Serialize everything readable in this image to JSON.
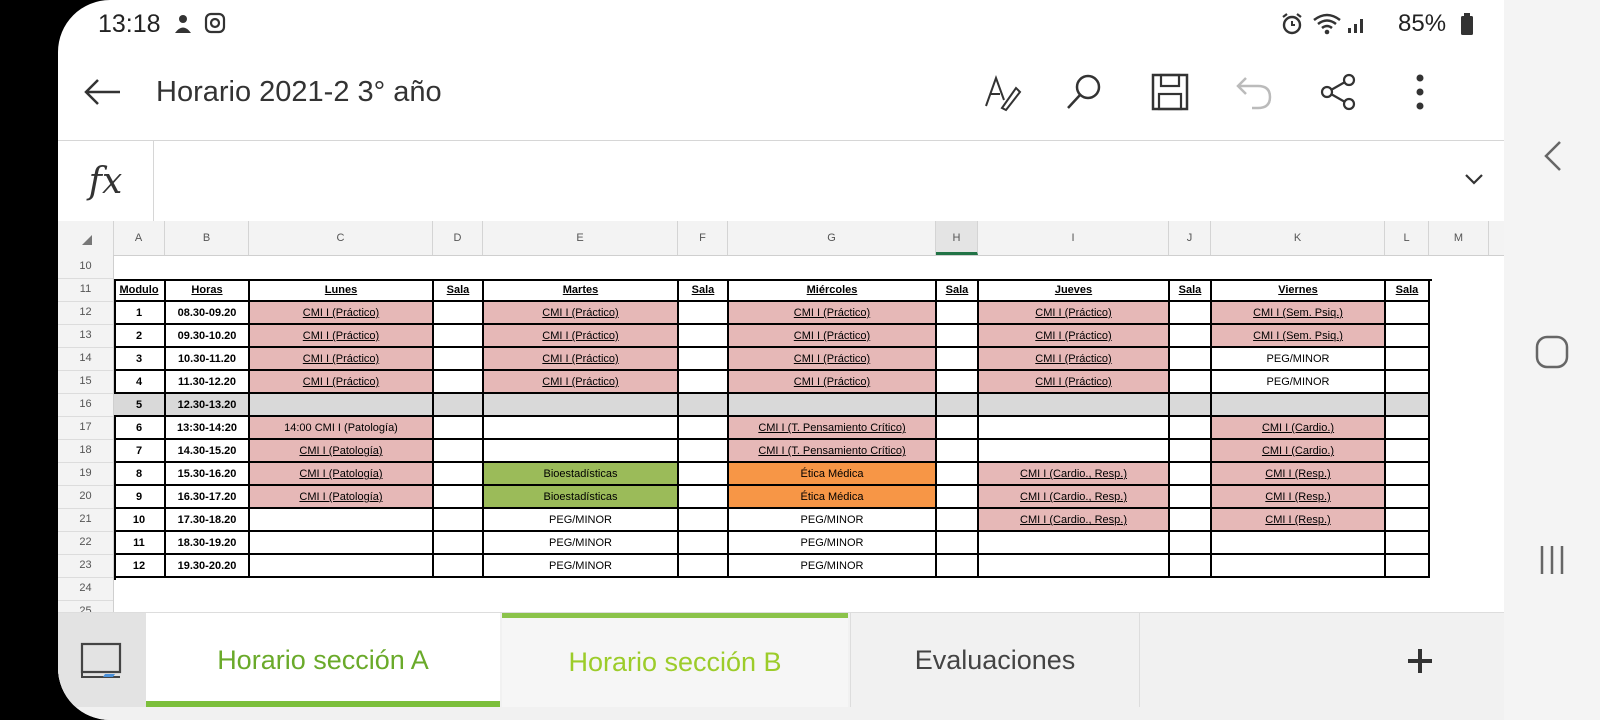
{
  "status": {
    "time": "13:18",
    "battery": "85%"
  },
  "app": {
    "title": "Horario 2021-2 3° año"
  },
  "formula": {
    "label": "fx",
    "value": ""
  },
  "columns": [
    "A",
    "B",
    "C",
    "D",
    "E",
    "F",
    "G",
    "H",
    "I",
    "J",
    "K",
    "L",
    "M"
  ],
  "selected_column": "H",
  "rows": [
    "10",
    "11",
    "12",
    "13",
    "14",
    "15",
    "16",
    "17",
    "18",
    "19",
    "20",
    "21",
    "22",
    "23",
    "24",
    "25"
  ],
  "table": {
    "headers": [
      "Modulo",
      "Horas",
      "Lunes",
      "Sala",
      "Martes",
      "Sala",
      "Miércoles",
      "Sala",
      "Jueves",
      "Sala",
      "Viernes",
      "Sala"
    ],
    "rows": [
      {
        "m": "1",
        "h": "08.30-09.20",
        "lun": "CMI I (Práctico)",
        "mar": "CMI I (Práctico)",
        "mie": "CMI I (Práctico)",
        "jue": "CMI I (Práctico)",
        "vie": "CMI I (Sem. Psiq.)"
      },
      {
        "m": "2",
        "h": "09.30-10.20",
        "lun": "CMI I (Práctico)",
        "mar": "CMI I (Práctico)",
        "mie": "CMI I (Práctico)",
        "jue": "CMI I (Práctico)",
        "vie": "CMI I (Sem. Psiq.)"
      },
      {
        "m": "3",
        "h": "10.30-11.20",
        "lun": "CMI I (Práctico)",
        "mar": "CMI I (Práctico)",
        "mie": "CMI I (Práctico)",
        "jue": "CMI I (Práctico)",
        "vie": "PEG/MINOR"
      },
      {
        "m": "4",
        "h": "11.30-12.20",
        "lun": "CMI I (Práctico)",
        "mar": "CMI I (Práctico)",
        "mie": "CMI I (Práctico)",
        "jue": "CMI I (Práctico)",
        "vie": "PEG/MINOR"
      },
      {
        "m": "5",
        "h": "12.30-13.20",
        "lun": "",
        "mar": "",
        "mie": "",
        "jue": "",
        "vie": ""
      },
      {
        "m": "6",
        "h": "13:30-14:20",
        "lun": "14:00 CMI I (Patología)",
        "mar": "",
        "mie": "CMI I (T. Pensamiento Crítico)",
        "jue": "",
        "vie": "CMI I (Cardio.)"
      },
      {
        "m": "7",
        "h": "14.30-15.20",
        "lun": "CMI I (Patología)",
        "mar": "",
        "mie": "CMI I (T. Pensamiento Crítico)",
        "jue": "",
        "vie": "CMI I (Cardio.)"
      },
      {
        "m": "8",
        "h": "15.30-16.20",
        "lun": "CMI I (Patología)",
        "mar": "Bioestadísticas",
        "mie": "Ética Médica",
        "jue": "CMI I (Cardio., Resp.)",
        "vie": "CMI I (Resp.)"
      },
      {
        "m": "9",
        "h": "16.30-17.20",
        "lun": "CMI I (Patología)",
        "mar": "Bioestadísticas",
        "mie": "Ética Médica",
        "jue": "CMI I (Cardio., Resp.)",
        "vie": "CMI I (Resp.)"
      },
      {
        "m": "10",
        "h": "17.30-18.20",
        "lun": "",
        "mar": "PEG/MINOR",
        "mie": "PEG/MINOR",
        "jue": "CMI I (Cardio., Resp.)",
        "vie": "CMI I (Resp.)"
      },
      {
        "m": "11",
        "h": "18.30-19.20",
        "lun": "",
        "mar": "PEG/MINOR",
        "mie": "PEG/MINOR",
        "jue": "",
        "vie": ""
      },
      {
        "m": "12",
        "h": "19.30-20.20",
        "lun": "",
        "mar": "PEG/MINOR",
        "mie": "PEG/MINOR",
        "jue": "",
        "vie": ""
      }
    ]
  },
  "tabs": [
    "Horario sección A",
    "Horario sección B",
    "Evaluaciones"
  ],
  "colors": {
    "pink": "#e6b8b7",
    "green": "#9bbb59",
    "orange": "#f79646",
    "gray": "#d9d9d9",
    "accent": "#7cbf3b"
  }
}
